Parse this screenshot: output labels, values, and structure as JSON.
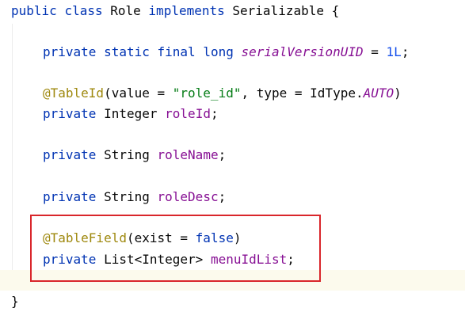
{
  "code": {
    "line1": {
      "kw1": "public",
      "kw2": "class",
      "name": "Role",
      "kw3": "implements",
      "iface": "Serializable",
      "brace": "{"
    },
    "line2": {
      "kw1": "private",
      "kw2": "static",
      "kw3": "final",
      "kw4": "long",
      "field": "serialVersionUID",
      "eq": "=",
      "num": "1L",
      "semi": ";"
    },
    "line3": {
      "annotation": "@TableId",
      "open": "(value = ",
      "str": "\"role_id\"",
      "mid": ", type = IdType.",
      "enum": "AUTO",
      "close": ")"
    },
    "line4": {
      "kw": "private",
      "type": "Integer",
      "field": "roleId",
      "semi": ";"
    },
    "line5": {
      "kw": "private",
      "type": "String",
      "field": "roleName",
      "semi": ";"
    },
    "line6": {
      "kw": "private",
      "type": "String",
      "field": "roleDesc",
      "semi": ";"
    },
    "line7": {
      "annotation": "@TableField",
      "open": "(exist = ",
      "kw": "false",
      "close": ")"
    },
    "line8": {
      "kw": "private",
      "type": "List<Integer>",
      "field": "menuIdList",
      "semi": ";"
    },
    "line9": {
      "brace": "}"
    }
  },
  "colors": {
    "keyword": "#0033b3",
    "annotation": "#9e880d",
    "string": "#067d17",
    "number": "#1750eb",
    "field": "#871094",
    "highlight_border": "#d9262b",
    "current_line": "#fcfaed"
  }
}
